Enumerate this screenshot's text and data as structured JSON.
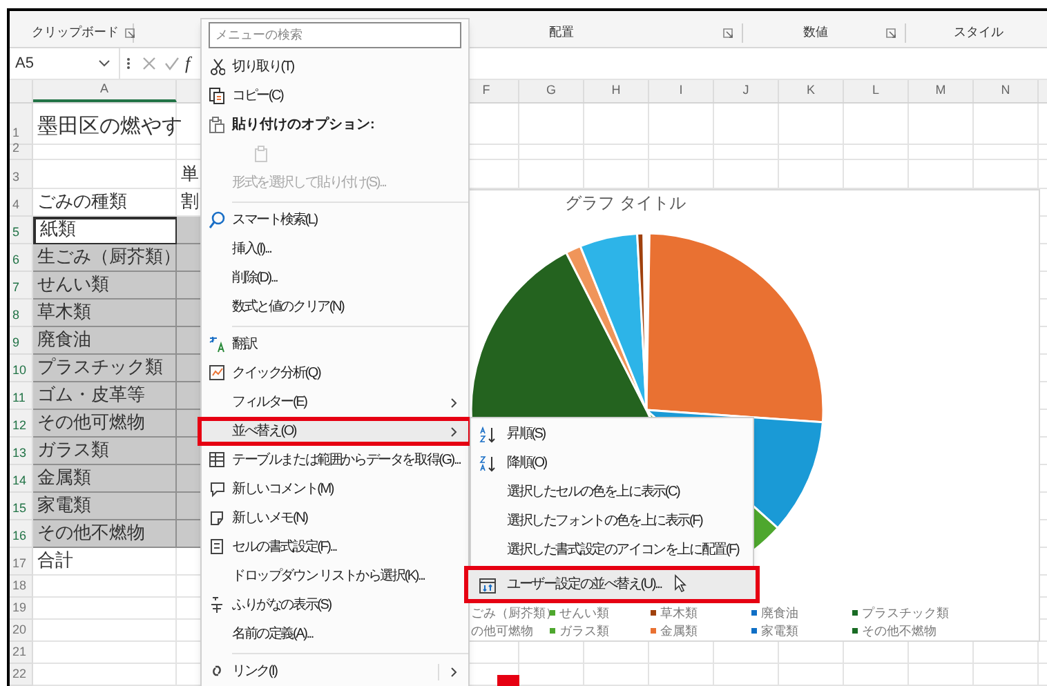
{
  "ribbon": {
    "groups": [
      {
        "label": "クリップボード",
        "launcher": true
      },
      {
        "label": "配置",
        "launcher": true
      },
      {
        "label": "数値",
        "launcher": true
      },
      {
        "label": "スタイル",
        "launcher": false
      }
    ]
  },
  "formula_bar": {
    "name_box": "A5",
    "function_label": "f"
  },
  "column_headers": [
    "A",
    "F",
    "G",
    "H",
    "I",
    "J",
    "K",
    "L",
    "M",
    "N"
  ],
  "rows": [
    {
      "number": "1",
      "a": "墨田区の燃やす",
      "selected": false,
      "active": false
    },
    {
      "number": "2",
      "selected": false,
      "active": false
    },
    {
      "number": "3",
      "b": "単",
      "selected": false,
      "active": false
    },
    {
      "number": "4",
      "a": "ごみの種類",
      "b": "割",
      "selected": false,
      "active": false
    },
    {
      "number": "5",
      "a": "紙類",
      "selected": true,
      "active": true
    },
    {
      "number": "6",
      "a": "生ごみ（厨芥類）",
      "selected": true,
      "active": false
    },
    {
      "number": "7",
      "a": "せんい類",
      "selected": true,
      "active": false
    },
    {
      "number": "8",
      "a": "草木類",
      "selected": true,
      "active": false
    },
    {
      "number": "9",
      "a": "廃食油",
      "selected": true,
      "active": false
    },
    {
      "number": "10",
      "a": "プラスチック類",
      "selected": true,
      "active": false
    },
    {
      "number": "11",
      "a": "ゴム・皮革等",
      "selected": true,
      "active": false
    },
    {
      "number": "12",
      "a": "その他可燃物",
      "selected": true,
      "active": false
    },
    {
      "number": "13",
      "a": "ガラス類",
      "selected": true,
      "active": false
    },
    {
      "number": "14",
      "a": "金属類",
      "selected": true,
      "active": false
    },
    {
      "number": "15",
      "a": "家電類",
      "selected": true,
      "active": false
    },
    {
      "number": "16",
      "a": "その他不燃物",
      "selected": true,
      "active": false
    },
    {
      "number": "17",
      "a": "合計",
      "selected": false,
      "active": false
    },
    {
      "number": "18",
      "selected": false,
      "active": false
    },
    {
      "number": "19",
      "selected": false,
      "active": false
    },
    {
      "number": "20",
      "selected": false,
      "active": false
    },
    {
      "number": "21",
      "selected": false,
      "active": false
    },
    {
      "number": "22",
      "selected": false,
      "active": false
    }
  ],
  "chart": {
    "title": "グラフ タイトル",
    "legend": [
      {
        "label": "ごみ（厨芥類）"
      },
      {
        "label": "せんい類",
        "color": "#4ea72e"
      },
      {
        "label": "草木類",
        "color": "#a0410d"
      },
      {
        "label": "廃食油",
        "color": "#0f6fc6"
      },
      {
        "label": "プラスチック類",
        "color": "#196b24"
      },
      {
        "label": "の他可燃物"
      },
      {
        "label": "ガラス類",
        "color": "#4ea72e"
      },
      {
        "label": "金属類",
        "color": "#e97132"
      },
      {
        "label": "家電類",
        "color": "#0f6fc6"
      },
      {
        "label": "その他不燃物",
        "color": "#196b24"
      }
    ]
  },
  "context_menu": {
    "items": [
      {
        "kind": "search",
        "placeholder": "メニューの検索"
      },
      {
        "kind": "command",
        "label": "切り取り(T)",
        "disabled": false,
        "submenu": false,
        "selected": false
      },
      {
        "kind": "command",
        "label": "コピー(C)",
        "disabled": false,
        "submenu": false,
        "selected": false
      },
      {
        "kind": "header",
        "label": "貼り付けのオプション:"
      },
      {
        "kind": "icon",
        "disabled": true
      },
      {
        "kind": "command",
        "label": "形式を選択して貼り付け(S)...",
        "disabled": true,
        "submenu": false,
        "selected": false
      },
      {
        "kind": "separator"
      },
      {
        "kind": "command",
        "label": "スマート検索(L)",
        "disabled": false,
        "submenu": false,
        "selected": false
      },
      {
        "kind": "command",
        "label": "挿入(I)...",
        "disabled": false,
        "submenu": false,
        "selected": false
      },
      {
        "kind": "command",
        "label": "削除(D)...",
        "disabled": false,
        "submenu": false,
        "selected": false
      },
      {
        "kind": "command",
        "label": "数式と値のクリア(N)",
        "disabled": false,
        "submenu": false,
        "selected": false
      },
      {
        "kind": "separator"
      },
      {
        "kind": "command",
        "label": "翻訳",
        "disabled": false,
        "submenu": false,
        "selected": false
      },
      {
        "kind": "command",
        "label": "クイック分析(Q)",
        "disabled": false,
        "submenu": false,
        "selected": false
      },
      {
        "kind": "command",
        "label": "フィルター(E)",
        "disabled": false,
        "submenu": true,
        "selected": false
      },
      {
        "kind": "command",
        "label": "並べ替え(O)",
        "disabled": false,
        "submenu": true,
        "selected": true
      },
      {
        "kind": "command",
        "label": "テーブルまたは範囲からデータを取得(G)...",
        "disabled": false,
        "submenu": false,
        "selected": false
      },
      {
        "kind": "command",
        "label": "新しいコメント(M)",
        "disabled": false,
        "submenu": false,
        "selected": false
      },
      {
        "kind": "command",
        "label": "新しいメモ(N)",
        "disabled": false,
        "submenu": false,
        "selected": false
      },
      {
        "kind": "command",
        "label": "セルの書式設定(F)...",
        "disabled": false,
        "submenu": false,
        "selected": false
      },
      {
        "kind": "command",
        "label": "ドロップダウン リストから選択(K)...",
        "disabled": false,
        "submenu": false,
        "selected": false
      },
      {
        "kind": "command",
        "label": "ふりがなの表示(S)",
        "disabled": false,
        "submenu": false,
        "selected": false
      },
      {
        "kind": "command",
        "label": "名前の定義(A)...",
        "disabled": false,
        "submenu": false,
        "selected": false
      },
      {
        "kind": "separator"
      },
      {
        "kind": "command",
        "label": "リンク(I)",
        "disabled": false,
        "submenu": true,
        "selected": false
      }
    ]
  },
  "submenu": {
    "items": [
      {
        "label": "昇順(S)",
        "selected": false
      },
      {
        "label": "降順(O)",
        "selected": false
      },
      {
        "label": "選択したセルの色を上に表示(C)",
        "selected": false
      },
      {
        "label": "選択したフォントの色を上に表示(F)",
        "selected": false
      },
      {
        "label": "選択した書式設定のアイコンを上に配置(F)",
        "selected": false
      },
      {
        "label": "ユーザー設定の並べ替え(U)...",
        "selected": true
      }
    ]
  }
}
